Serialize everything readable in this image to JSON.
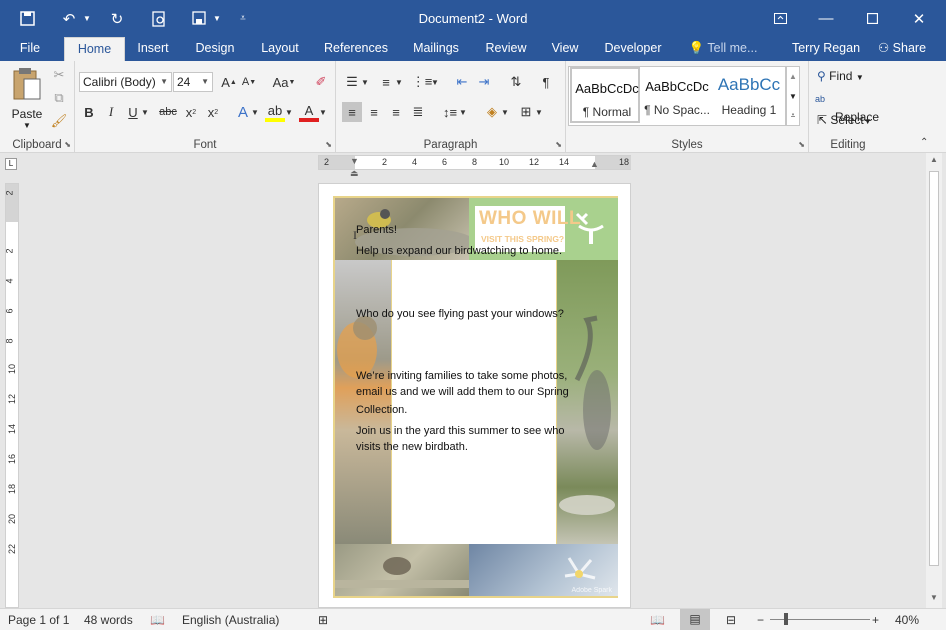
{
  "window": {
    "title": "Document2 - Word"
  },
  "tabs": [
    {
      "label": "File"
    },
    {
      "label": "Home"
    },
    {
      "label": "Insert"
    },
    {
      "label": "Design"
    },
    {
      "label": "Layout"
    },
    {
      "label": "References"
    },
    {
      "label": "Mailings"
    },
    {
      "label": "Review"
    },
    {
      "label": "View"
    },
    {
      "label": "Developer"
    },
    {
      "label": "Tell me..."
    }
  ],
  "account": {
    "user": "Terry Regan",
    "share": "Share"
  },
  "clipboard": {
    "paste": "Paste",
    "label": "Clipboard"
  },
  "font": {
    "family": "Calibri (Body)",
    "size": "24",
    "label": "Font"
  },
  "paragraph": {
    "label": "Paragraph"
  },
  "styles": {
    "label": "Styles",
    "items": [
      {
        "preview": "AaBbCcDc",
        "name": "¶ Normal"
      },
      {
        "preview": "AaBbCcDc",
        "name": "¶ No Spac..."
      },
      {
        "preview": "AaBbCc",
        "name": "Heading 1"
      }
    ]
  },
  "editing": {
    "label": "Editing",
    "find": "Find",
    "replace": "Replace",
    "select": "Select"
  },
  "ruler": {
    "h_ticks": [
      "2",
      "2",
      "4",
      "6",
      "8",
      "10",
      "12",
      "14",
      "18"
    ],
    "v_ticks": [
      "2",
      "2",
      "4",
      "6",
      "8",
      "10",
      "12",
      "14",
      "16",
      "18",
      "20",
      "22"
    ]
  },
  "document": {
    "poster_title_1": "WHO WILL",
    "poster_title_2": "VISIT THIS SPRING?",
    "watermark": "Adobe Spark",
    "lines": [
      "Parents!",
      "Help us expand our birdwatching to home.",
      "Who do you see flying past your windows?",
      "We’re inviting families to take some photos,",
      "email us and we will add them to our Spring",
      "Collection.",
      "Join us in the yard this summer to see who",
      "visits the new birdbath."
    ]
  },
  "status": {
    "page": "Page 1 of 1",
    "words": "48 words",
    "language": "English (Australia)",
    "zoom": "40%"
  }
}
